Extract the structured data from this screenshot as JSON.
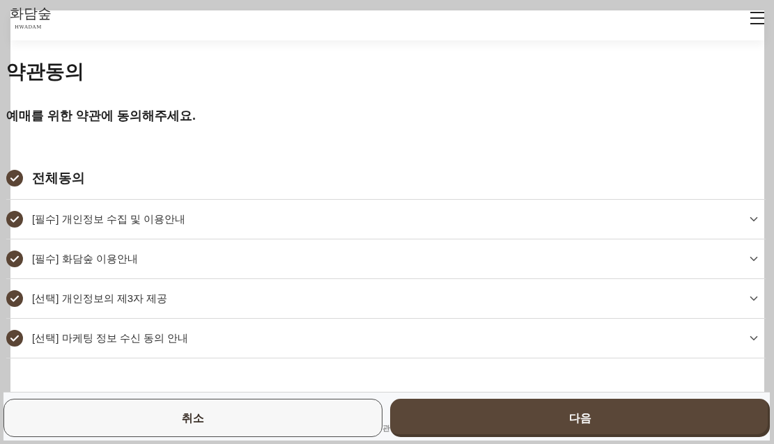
{
  "header": {
    "logo": {
      "name": "화담숲",
      "subtitle": "HWADAM"
    }
  },
  "page": {
    "title": "약관동의",
    "subtitle": "예매를 위한 약관에 동의해주세요."
  },
  "agree_all": {
    "label": "전체동의",
    "checked": true
  },
  "terms": [
    {
      "label": "[필수] 개인정보 수집 및 이용안내",
      "checked": true,
      "expanded": false
    },
    {
      "label": "[필수] 화담숲 이용안내",
      "checked": true,
      "expanded": false
    },
    {
      "label": "[선택] 개인정보의 제3자 제공",
      "checked": true,
      "expanded": false
    },
    {
      "label": "[선택] 마케팅 정보 수신 동의 안내",
      "checked": true,
      "expanded": false
    }
  ],
  "footer": {
    "partial_text": "관",
    "buttons": [
      {
        "label": "취소",
        "kind": "secondary"
      },
      {
        "label": "다음",
        "kind": "primary"
      }
    ]
  }
}
